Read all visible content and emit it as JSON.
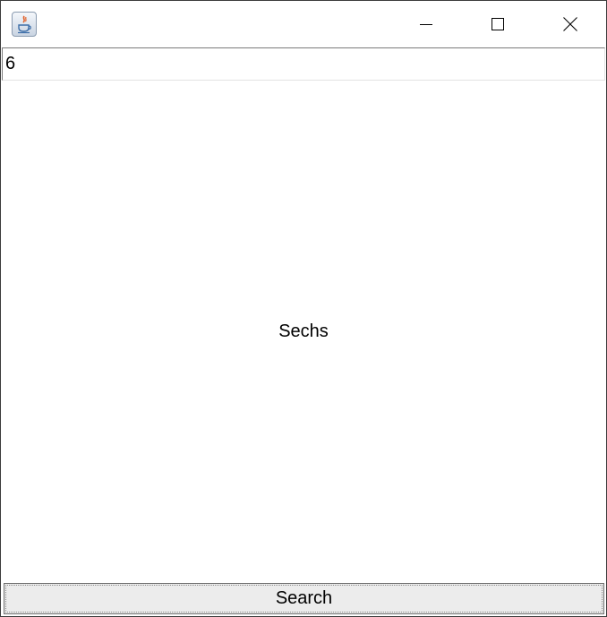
{
  "window": {
    "controls": {
      "minimize_icon": "minimize-icon",
      "maximize_icon": "maximize-icon",
      "close_icon": "close-icon"
    },
    "app_icon": "java-icon"
  },
  "search": {
    "input_value": "6"
  },
  "result": {
    "text": "Sechs"
  },
  "actions": {
    "search_label": "Search"
  },
  "colors": {
    "background": "#ffffff",
    "button_bg": "#ececec",
    "border": "#3c3c3c"
  }
}
